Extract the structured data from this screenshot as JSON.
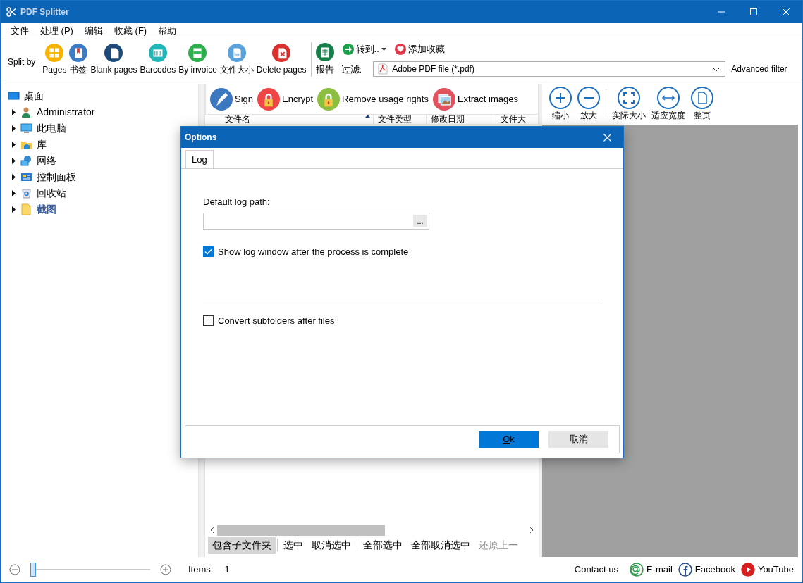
{
  "window": {
    "title": "PDF Splitter"
  },
  "menu": [
    "文件",
    "处理 (P)",
    "编辑",
    "收藏 (F)",
    "帮助"
  ],
  "split_toolbar": {
    "label": "Split by",
    "buttons": [
      {
        "label": "Pages",
        "kind": "grid",
        "color": "#f4b400"
      },
      {
        "label": "书签",
        "kind": "bookmark",
        "color": "#3d7cc4"
      },
      {
        "label": "Blank pages",
        "kind": "page",
        "color": "#1d4a78"
      },
      {
        "label": "Barcodes",
        "kind": "barcode",
        "color": "#20b6b6"
      },
      {
        "label": "By invoice",
        "kind": "invoice",
        "color": "#2fae4e"
      },
      {
        "label": "文件大小",
        "kind": "size",
        "color": "#5aa2dc"
      },
      {
        "label": "Delete pages",
        "kind": "delete",
        "color": "#d8302d"
      }
    ],
    "report": {
      "label": "报告",
      "kind": "sheet",
      "color": "#17804a"
    }
  },
  "goto": {
    "label": "转到.."
  },
  "favorite": {
    "label": "添加收藏"
  },
  "filter": {
    "label": "过滤:",
    "value": "Adobe PDF file (*.pdf)",
    "advanced": "Advanced filter"
  },
  "tree": [
    {
      "label": "桌面",
      "kind": "desktop",
      "selected": false,
      "children": [
        {
          "label": "Administrator",
          "kind": "user",
          "expanded": false,
          "selected": false
        },
        {
          "label": "此电脑",
          "kind": "computer",
          "expanded": false,
          "selected": false
        },
        {
          "label": "库",
          "kind": "library",
          "expanded": false,
          "selected": false
        },
        {
          "label": "网络",
          "kind": "network",
          "expanded": false,
          "selected": false
        },
        {
          "label": "控制面板",
          "kind": "control",
          "expanded": false,
          "selected": false
        },
        {
          "label": "回收站",
          "kind": "recycle",
          "expanded": false,
          "selected": false
        },
        {
          "label": "截图",
          "kind": "folder",
          "expanded": false,
          "selected": true
        }
      ]
    }
  ],
  "actions": [
    {
      "label": "Sign",
      "kind": "pen",
      "color": "#3b78c0"
    },
    {
      "label": "Encrypt",
      "kind": "lock",
      "color": "#ef4545"
    },
    {
      "label": "Remove usage rights",
      "kind": "lock",
      "color": "#8cbf3f"
    },
    {
      "label": "Extract images",
      "kind": "images",
      "color": "#e0525e"
    }
  ],
  "columns": [
    {
      "label": "文件名",
      "sorted": true
    },
    {
      "label": "文件类型",
      "sorted": false
    },
    {
      "label": "修改日期",
      "sorted": false
    },
    {
      "label": "文件大",
      "sorted": false
    }
  ],
  "viewer_tools": [
    {
      "label": "缩小",
      "kind": "plus",
      "separator_before": false
    },
    {
      "label": "放大",
      "kind": "minus",
      "separator_before": false
    },
    {
      "label": "实际大小",
      "kind": "actual",
      "separator_before": true
    },
    {
      "label": "适应宽度",
      "kind": "width",
      "separator_before": false
    },
    {
      "label": "整页",
      "kind": "page",
      "separator_before": false
    }
  ],
  "list_buttons": [
    {
      "label": "包含子文件夹",
      "checked": true,
      "disabled": false,
      "separator_before": false
    },
    {
      "label": "选中",
      "checked": false,
      "disabled": false,
      "separator_before": true
    },
    {
      "label": "取消选中",
      "checked": false,
      "disabled": false,
      "separator_before": false
    },
    {
      "label": "全部选中",
      "checked": false,
      "disabled": false,
      "separator_before": true
    },
    {
      "label": "全部取消选中",
      "checked": false,
      "disabled": false,
      "separator_before": false
    },
    {
      "label": "还原上一",
      "checked": false,
      "disabled": true,
      "separator_before": false
    }
  ],
  "status": {
    "zoom": {
      "level": 0
    },
    "items_label": "Items:",
    "items_count": "1",
    "contact": "Contact us",
    "links": [
      {
        "label": "E-mail",
        "kind": "email",
        "color": "#2e9a4a"
      },
      {
        "label": "Facebook",
        "kind": "facebook",
        "color": "#2a4f8f"
      },
      {
        "label": "YouTube",
        "kind": "youtube",
        "color": "#d62020"
      }
    ]
  },
  "dialog": {
    "title": "Options",
    "tabs": [
      {
        "label": "Log",
        "selected": true
      }
    ],
    "path_label": "Default log path:",
    "browse": "...",
    "options": [
      {
        "label": "Show log window after the process is complete",
        "checked": true
      },
      {
        "label": "Convert subfolders after files",
        "checked": false
      }
    ],
    "buttons": [
      {
        "label": "Ok",
        "kind": "primary"
      },
      {
        "label": "取消",
        "kind": "secondary"
      }
    ]
  }
}
